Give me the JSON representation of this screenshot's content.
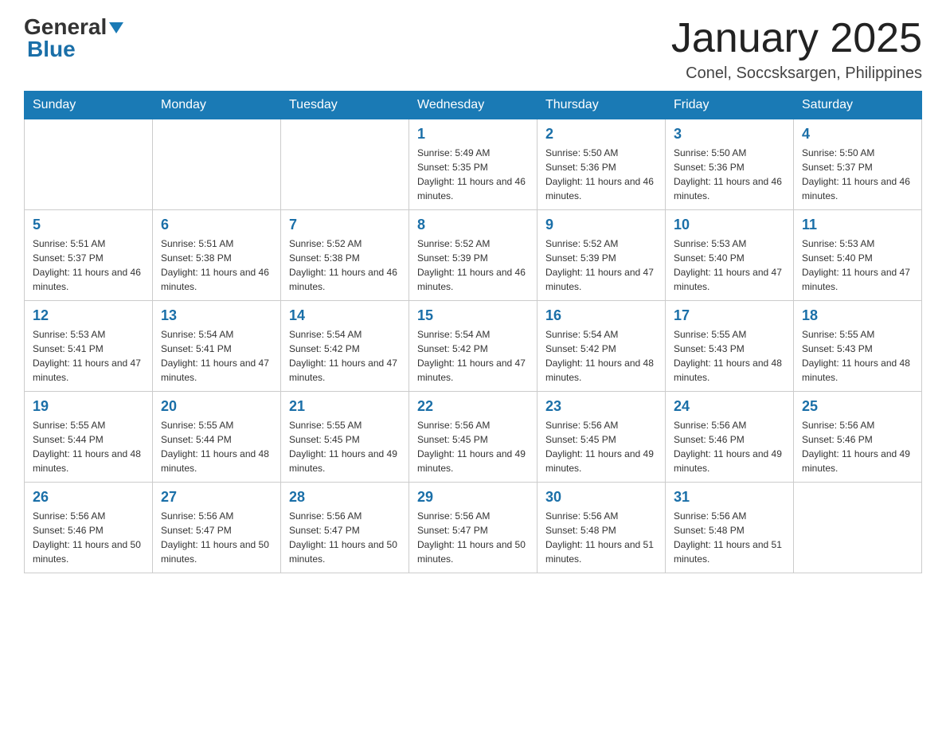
{
  "header": {
    "logo": {
      "general": "General",
      "blue": "Blue"
    },
    "title": "January 2025",
    "location": "Conel, Soccsksargen, Philippines"
  },
  "calendar": {
    "weekdays": [
      "Sunday",
      "Monday",
      "Tuesday",
      "Wednesday",
      "Thursday",
      "Friday",
      "Saturday"
    ],
    "weeks": [
      [
        {
          "day": "",
          "info": ""
        },
        {
          "day": "",
          "info": ""
        },
        {
          "day": "",
          "info": ""
        },
        {
          "day": "1",
          "info": "Sunrise: 5:49 AM\nSunset: 5:35 PM\nDaylight: 11 hours and 46 minutes."
        },
        {
          "day": "2",
          "info": "Sunrise: 5:50 AM\nSunset: 5:36 PM\nDaylight: 11 hours and 46 minutes."
        },
        {
          "day": "3",
          "info": "Sunrise: 5:50 AM\nSunset: 5:36 PM\nDaylight: 11 hours and 46 minutes."
        },
        {
          "day": "4",
          "info": "Sunrise: 5:50 AM\nSunset: 5:37 PM\nDaylight: 11 hours and 46 minutes."
        }
      ],
      [
        {
          "day": "5",
          "info": "Sunrise: 5:51 AM\nSunset: 5:37 PM\nDaylight: 11 hours and 46 minutes."
        },
        {
          "day": "6",
          "info": "Sunrise: 5:51 AM\nSunset: 5:38 PM\nDaylight: 11 hours and 46 minutes."
        },
        {
          "day": "7",
          "info": "Sunrise: 5:52 AM\nSunset: 5:38 PM\nDaylight: 11 hours and 46 minutes."
        },
        {
          "day": "8",
          "info": "Sunrise: 5:52 AM\nSunset: 5:39 PM\nDaylight: 11 hours and 46 minutes."
        },
        {
          "day": "9",
          "info": "Sunrise: 5:52 AM\nSunset: 5:39 PM\nDaylight: 11 hours and 47 minutes."
        },
        {
          "day": "10",
          "info": "Sunrise: 5:53 AM\nSunset: 5:40 PM\nDaylight: 11 hours and 47 minutes."
        },
        {
          "day": "11",
          "info": "Sunrise: 5:53 AM\nSunset: 5:40 PM\nDaylight: 11 hours and 47 minutes."
        }
      ],
      [
        {
          "day": "12",
          "info": "Sunrise: 5:53 AM\nSunset: 5:41 PM\nDaylight: 11 hours and 47 minutes."
        },
        {
          "day": "13",
          "info": "Sunrise: 5:54 AM\nSunset: 5:41 PM\nDaylight: 11 hours and 47 minutes."
        },
        {
          "day": "14",
          "info": "Sunrise: 5:54 AM\nSunset: 5:42 PM\nDaylight: 11 hours and 47 minutes."
        },
        {
          "day": "15",
          "info": "Sunrise: 5:54 AM\nSunset: 5:42 PM\nDaylight: 11 hours and 47 minutes."
        },
        {
          "day": "16",
          "info": "Sunrise: 5:54 AM\nSunset: 5:42 PM\nDaylight: 11 hours and 48 minutes."
        },
        {
          "day": "17",
          "info": "Sunrise: 5:55 AM\nSunset: 5:43 PM\nDaylight: 11 hours and 48 minutes."
        },
        {
          "day": "18",
          "info": "Sunrise: 5:55 AM\nSunset: 5:43 PM\nDaylight: 11 hours and 48 minutes."
        }
      ],
      [
        {
          "day": "19",
          "info": "Sunrise: 5:55 AM\nSunset: 5:44 PM\nDaylight: 11 hours and 48 minutes."
        },
        {
          "day": "20",
          "info": "Sunrise: 5:55 AM\nSunset: 5:44 PM\nDaylight: 11 hours and 48 minutes."
        },
        {
          "day": "21",
          "info": "Sunrise: 5:55 AM\nSunset: 5:45 PM\nDaylight: 11 hours and 49 minutes."
        },
        {
          "day": "22",
          "info": "Sunrise: 5:56 AM\nSunset: 5:45 PM\nDaylight: 11 hours and 49 minutes."
        },
        {
          "day": "23",
          "info": "Sunrise: 5:56 AM\nSunset: 5:45 PM\nDaylight: 11 hours and 49 minutes."
        },
        {
          "day": "24",
          "info": "Sunrise: 5:56 AM\nSunset: 5:46 PM\nDaylight: 11 hours and 49 minutes."
        },
        {
          "day": "25",
          "info": "Sunrise: 5:56 AM\nSunset: 5:46 PM\nDaylight: 11 hours and 49 minutes."
        }
      ],
      [
        {
          "day": "26",
          "info": "Sunrise: 5:56 AM\nSunset: 5:46 PM\nDaylight: 11 hours and 50 minutes."
        },
        {
          "day": "27",
          "info": "Sunrise: 5:56 AM\nSunset: 5:47 PM\nDaylight: 11 hours and 50 minutes."
        },
        {
          "day": "28",
          "info": "Sunrise: 5:56 AM\nSunset: 5:47 PM\nDaylight: 11 hours and 50 minutes."
        },
        {
          "day": "29",
          "info": "Sunrise: 5:56 AM\nSunset: 5:47 PM\nDaylight: 11 hours and 50 minutes."
        },
        {
          "day": "30",
          "info": "Sunrise: 5:56 AM\nSunset: 5:48 PM\nDaylight: 11 hours and 51 minutes."
        },
        {
          "day": "31",
          "info": "Sunrise: 5:56 AM\nSunset: 5:48 PM\nDaylight: 11 hours and 51 minutes."
        },
        {
          "day": "",
          "info": ""
        }
      ]
    ]
  }
}
